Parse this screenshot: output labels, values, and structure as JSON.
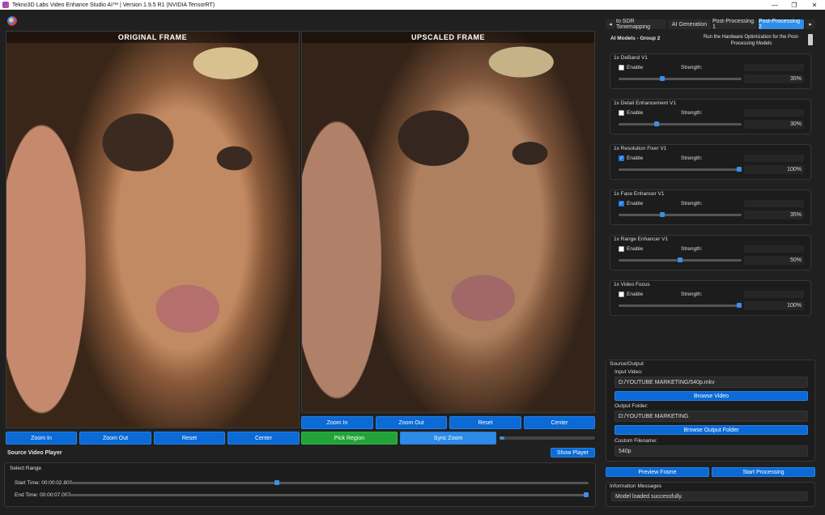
{
  "window": {
    "title": "Tekno3D Labs Video Enhance Studio AI™ | Version 1.9.5 R1 (NVIDIA TensorRT)",
    "controls": [
      "—",
      "❐",
      "✕"
    ]
  },
  "frames": {
    "original_label": "ORIGINAL FRAME",
    "upscaled_label": "UPSCALED FRAME"
  },
  "left_buttons": [
    "Zoom In",
    "Zoom Out",
    "Reset",
    "Center"
  ],
  "right_buttons": [
    "Zoom In",
    "Zoom Out",
    "Reset",
    "Center"
  ],
  "region": {
    "pick_label": "Pick Region",
    "sync_label": "Sync Zoom",
    "progress": 0.05
  },
  "player": {
    "title": "Source Video Player",
    "show_label": "Show Player"
  },
  "range": {
    "title": "Select Range",
    "start_label": "Start Time: 00:00:02.802",
    "end_label": "End Time: 00:00:07.007",
    "start_pos": 0.4,
    "end_pos": 1.0
  },
  "tabs": {
    "prev_arrow": "◂",
    "next_arrow": "▸",
    "items": [
      "to SDR Tonemapping",
      "AI Generation",
      "Post-Processing 1",
      "Post-Processing 2"
    ],
    "active_index": 3
  },
  "models": {
    "group_title": "AI Models - Group 2",
    "hw_text": "Run the Hardware Optimization for the Post-Processing Models",
    "enable_label": "Enable",
    "strength_label": "Strength:",
    "items": [
      {
        "name": "1x DeBand V1",
        "enabled": false,
        "value": "35%",
        "level": 0.35
      },
      {
        "name": "1x Detail Enhancement V1",
        "enabled": false,
        "value": "30%",
        "level": 0.3
      },
      {
        "name": "1x Resolution Fixer V1",
        "enabled": true,
        "value": "100%",
        "level": 1.0
      },
      {
        "name": "1x Face Enhancer V1",
        "enabled": true,
        "value": "35%",
        "level": 0.35
      },
      {
        "name": "1x Range Enhancer V1",
        "enabled": false,
        "value": "50%",
        "level": 0.5
      },
      {
        "name": "1x Video Focus",
        "enabled": false,
        "value": "100%",
        "level": 1.0
      }
    ]
  },
  "source_output": {
    "title": "Source/Output",
    "input_label": "Input Video:",
    "input_value": "D:/YOUTUBE MARKETING/540p.mkv",
    "browse_video": "Browse Video",
    "output_label": "Output Folder:",
    "output_value": "D:/YOUTUBE MARKETING",
    "browse_output": "Browse Output Folder",
    "filename_label": "Custom Filename:",
    "filename_value": "540p"
  },
  "actions": {
    "preview": "Preview Frame",
    "start": "Start Processing"
  },
  "info": {
    "title": "Information Messages",
    "message": "Model loaded successfully."
  }
}
